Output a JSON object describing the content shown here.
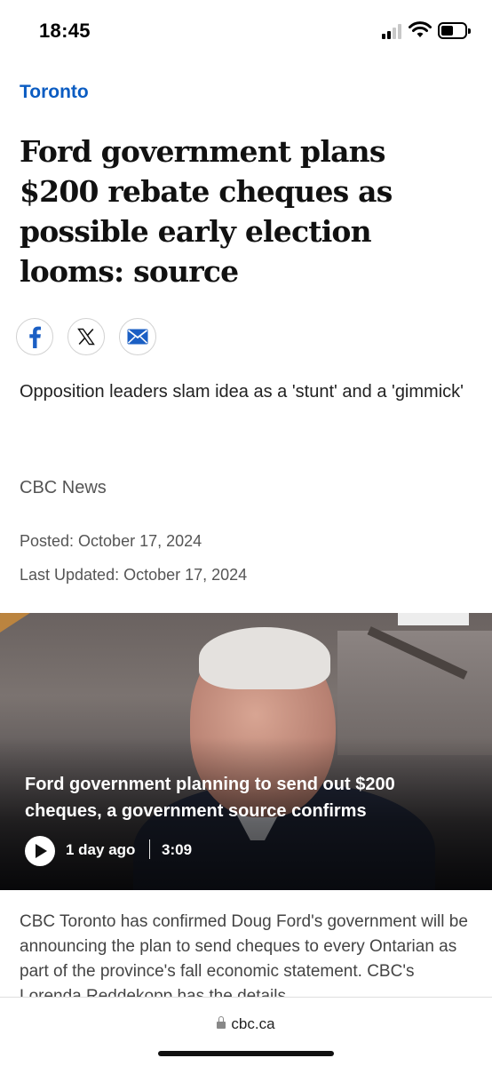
{
  "status_bar": {
    "time": "18:45",
    "icons": [
      "cellular-signal-icon",
      "wifi-icon",
      "battery-icon"
    ]
  },
  "article": {
    "section": "Toronto",
    "headline": "Ford government plans $200 rebate cheques as possible early election looms: source",
    "share": {
      "icons": [
        "facebook-icon",
        "x-icon",
        "mail-icon"
      ]
    },
    "deck": "Opposition leaders slam idea as a 'stunt' and a 'gimmick'",
    "byline": "CBC News",
    "posted": "Posted: October 17, 2024",
    "updated": "Last Updated: October 17, 2024"
  },
  "video": {
    "title": "Ford government planning to send out $200 cheques, a government source confirms",
    "age": "1 day ago",
    "duration": "3:09"
  },
  "summary": "CBC Toronto has confirmed Doug Ford's government will be announcing the plan to send cheques to every Ontarian as part of the province's fall economic statement. CBC's Lorenda Reddekopp has the details.",
  "browser": {
    "url": "cbc.ca"
  },
  "colors": {
    "section_link": "#0b5cc2",
    "facebook": "#1b5fc4",
    "mail": "#1b5fc4"
  }
}
